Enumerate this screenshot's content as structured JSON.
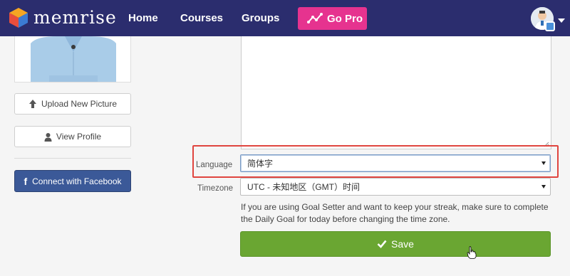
{
  "header": {
    "brand": "memrise",
    "nav": [
      "Home",
      "Courses",
      "Groups"
    ],
    "go_pro_label": "Go Pro",
    "icons": {
      "logo": "memrise-logo-icon",
      "go_pro": "trend-chart-icon",
      "avatar_caret": "caret-down-icon"
    }
  },
  "sidebar": {
    "upload_label": "Upload New Picture",
    "view_profile_label": "View Profile",
    "facebook_label": "Connect with Facebook",
    "icons": {
      "upload": "upload-arrow-icon",
      "profile": "user-icon",
      "facebook": "facebook-icon"
    }
  },
  "form": {
    "language_label": "Language",
    "language_value": "简体字",
    "timezone_label": "Timezone",
    "timezone_value": "UTC - 未知地区（GMT）时间",
    "help_text": "If you are using Goal Setter and want to keep your streak, make sure to complete the Daily Goal for today before changing the time zone.",
    "save_label": "Save"
  },
  "colors": {
    "nav_bg": "#2b2d6e",
    "go_pro": "#e6338f",
    "facebook": "#3b5998",
    "save": "#6aa632",
    "highlight": "#e0453f"
  }
}
